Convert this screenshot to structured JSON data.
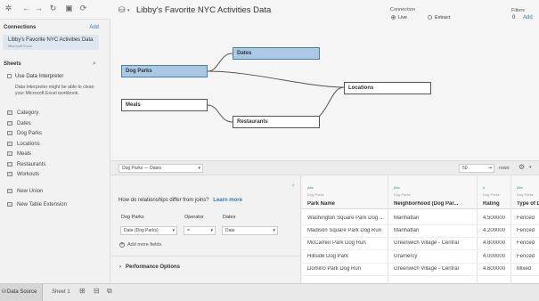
{
  "toolbar": {
    "icons": [
      "tableau-logo-icon",
      "back-icon",
      "forward-icon",
      "redo-icon",
      "save-icon",
      "refresh-icon"
    ]
  },
  "left": {
    "connections_title": "Connections",
    "add_label": "Add",
    "connection_name": "Libby's Favorite NYC Activities Data",
    "connection_sub": "Microsoft Excel",
    "sheets_title": "Sheets",
    "use_interpreter": "Use Data Interpreter",
    "interpreter_note": "Data Interpreter might be able to clean your Microsoft Excel workbook.",
    "sheets": [
      "Category",
      "Dates",
      "Dog Parks",
      "Locations",
      "Meals",
      "Restaurants",
      "Workouts"
    ],
    "new_union": "New Union",
    "new_table_extension": "New Table Extension"
  },
  "header": {
    "title": "Libby's Favorite NYC Activities Data",
    "connection_label": "Connection",
    "live": "Live",
    "extract": "Extract",
    "filters_label": "Filters",
    "filters_count": "0",
    "filters_add": "Add"
  },
  "canvas": {
    "nodes": {
      "dog_parks": "Dog Parks",
      "dates": "Dates",
      "meals": "Meals",
      "locations": "Locations",
      "restaurants": "Restaurants"
    }
  },
  "midbar": {
    "relationship": "Dog Parks — Dates",
    "rows_value": "50",
    "rows_label": "rows"
  },
  "relpanel": {
    "question": "How do relationships differ from joins?",
    "learn_more": "Learn more",
    "left_table": "Dog Parks",
    "operator_label": "Operator",
    "right_table": "Dates",
    "left_field": "Date (Dog Parks)",
    "operator": "=",
    "right_field": "Date",
    "add_fields": "Add more fields",
    "performance": "Performance Options"
  },
  "grid": {
    "columns": [
      {
        "type": "Abc",
        "source": "Dog Parks",
        "name": "Park Name"
      },
      {
        "type": "Abc",
        "source": "Dog Parks",
        "name": "Neighborhood (Dog Par..."
      },
      {
        "type": "#",
        "source": "Dog Parks",
        "name": "Rating"
      },
      {
        "type": "Abc",
        "source": "Dog Parks",
        "name": "Type of D"
      }
    ],
    "rows": [
      [
        "Washington Square Park Dog ...",
        "Manhattan",
        "4.500000",
        "Fenced"
      ],
      [
        "Madison Square Park Dog Run",
        "Manhattan",
        "4.200000",
        "Fenced"
      ],
      [
        "McCarren Park Dog Run",
        "Greenwich Village - Central",
        "4.800000",
        "Fenced"
      ],
      [
        "Hillside Dog Park",
        "Gramercy",
        "4.000000",
        "Fenced"
      ],
      [
        "Domino Park Dog Run",
        "Greenwich Village - Central",
        "4.600000",
        "Mixed"
      ]
    ]
  },
  "statusbar": {
    "data_source": "Data Source",
    "sheet1": "Sheet 1"
  }
}
